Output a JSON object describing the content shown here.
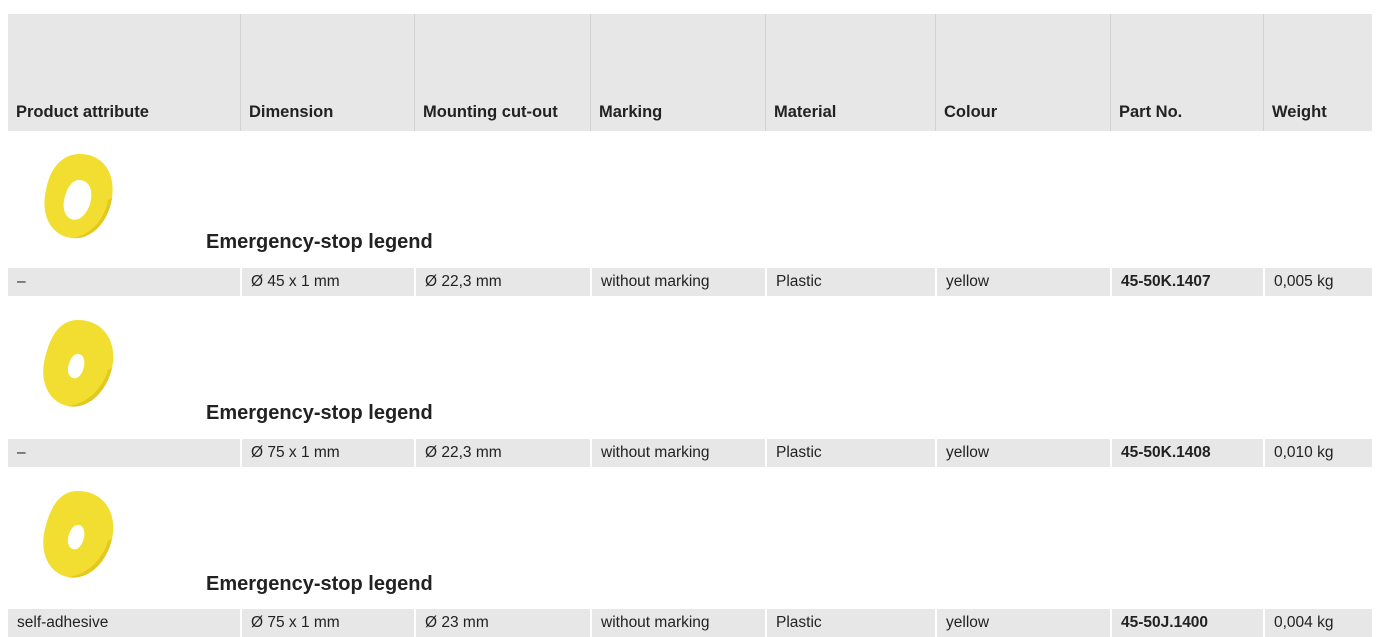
{
  "table": {
    "headers": [
      "Product attribute",
      "Dimension",
      "Mounting cut-out",
      "Marking",
      "Material",
      "Colour",
      "Part No.",
      "Weight"
    ]
  },
  "products": [
    {
      "title": "Emergency-stop legend",
      "image_icon": "yellow-ring-small-hole",
      "row": {
        "attribute": "–",
        "dimension": "Ø 45 x 1 mm",
        "mounting_cutout": "Ø 22,3 mm",
        "marking": "without marking",
        "material": "Plastic",
        "colour": "yellow",
        "part_no": "45-50K.1407",
        "weight": "0,005 kg"
      }
    },
    {
      "title": "Emergency-stop legend",
      "image_icon": "yellow-ring-large",
      "row": {
        "attribute": "–",
        "dimension": "Ø 75 x 1 mm",
        "mounting_cutout": "Ø 22,3 mm",
        "marking": "without marking",
        "material": "Plastic",
        "colour": "yellow",
        "part_no": "45-50K.1408",
        "weight": "0,010 kg"
      }
    },
    {
      "title": "Emergency-stop legend",
      "image_icon": "yellow-ring-large",
      "row": {
        "attribute": "self-adhesive",
        "dimension": "Ø 75 x 1 mm",
        "mounting_cutout": "Ø 23 mm",
        "marking": "without marking",
        "material": "Plastic",
        "colour": "yellow",
        "part_no": "45-50J.1400",
        "weight": "0,004 kg"
      }
    }
  ],
  "colors": {
    "header_bg": "#e7e7e7",
    "row_bg": "#e7e7e7",
    "legend_yellow": "#f5e13a"
  }
}
